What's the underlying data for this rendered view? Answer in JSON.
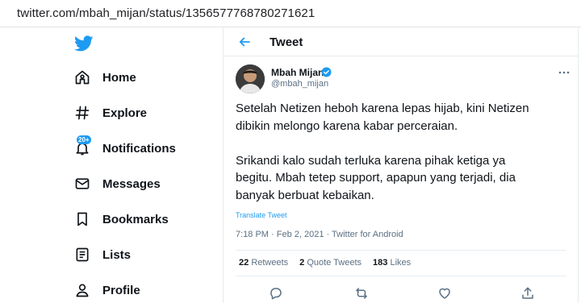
{
  "browser": {
    "url": "twitter.com/mbah_mijan/status/1356577768780271621"
  },
  "sidebar": {
    "logo": "twitter-bird-icon",
    "items": [
      {
        "label": "Home",
        "icon": "home-icon"
      },
      {
        "label": "Explore",
        "icon": "hashtag-icon"
      },
      {
        "label": "Notifications",
        "icon": "bell-icon",
        "badge": "20+"
      },
      {
        "label": "Messages",
        "icon": "envelope-icon"
      },
      {
        "label": "Bookmarks",
        "icon": "bookmark-icon"
      },
      {
        "label": "Lists",
        "icon": "list-icon"
      },
      {
        "label": "Profile",
        "icon": "person-icon"
      }
    ]
  },
  "header": {
    "title": "Tweet"
  },
  "tweet": {
    "author_name": "Mbah Mijan",
    "author_handle": "@mbah_mijan",
    "text": "Setelah Netizen heboh karena lepas hijab, kini Netizen\ndibikin melongo karena kabar perceraian.\n\nSrikandi kalo sudah terluka karena pihak ketiga ya\nbegitu. Mbah tetep support, apapun yang terjadi, dia\nbanyak berbuat kebaikan.",
    "translate_label": "Translate Tweet",
    "meta": "7:18 PM · Feb 2, 2021 · Twitter for Android",
    "stats": {
      "retweets_count": "22",
      "retweets_label": "Retweets",
      "quotes_count": "2",
      "quotes_label": "Quote Tweets",
      "likes_count": "183",
      "likes_label": "Likes"
    }
  },
  "colors": {
    "accent": "#1d9bf0",
    "text": "#0f1419",
    "muted": "#5b7083",
    "border": "#e6ecf0"
  }
}
